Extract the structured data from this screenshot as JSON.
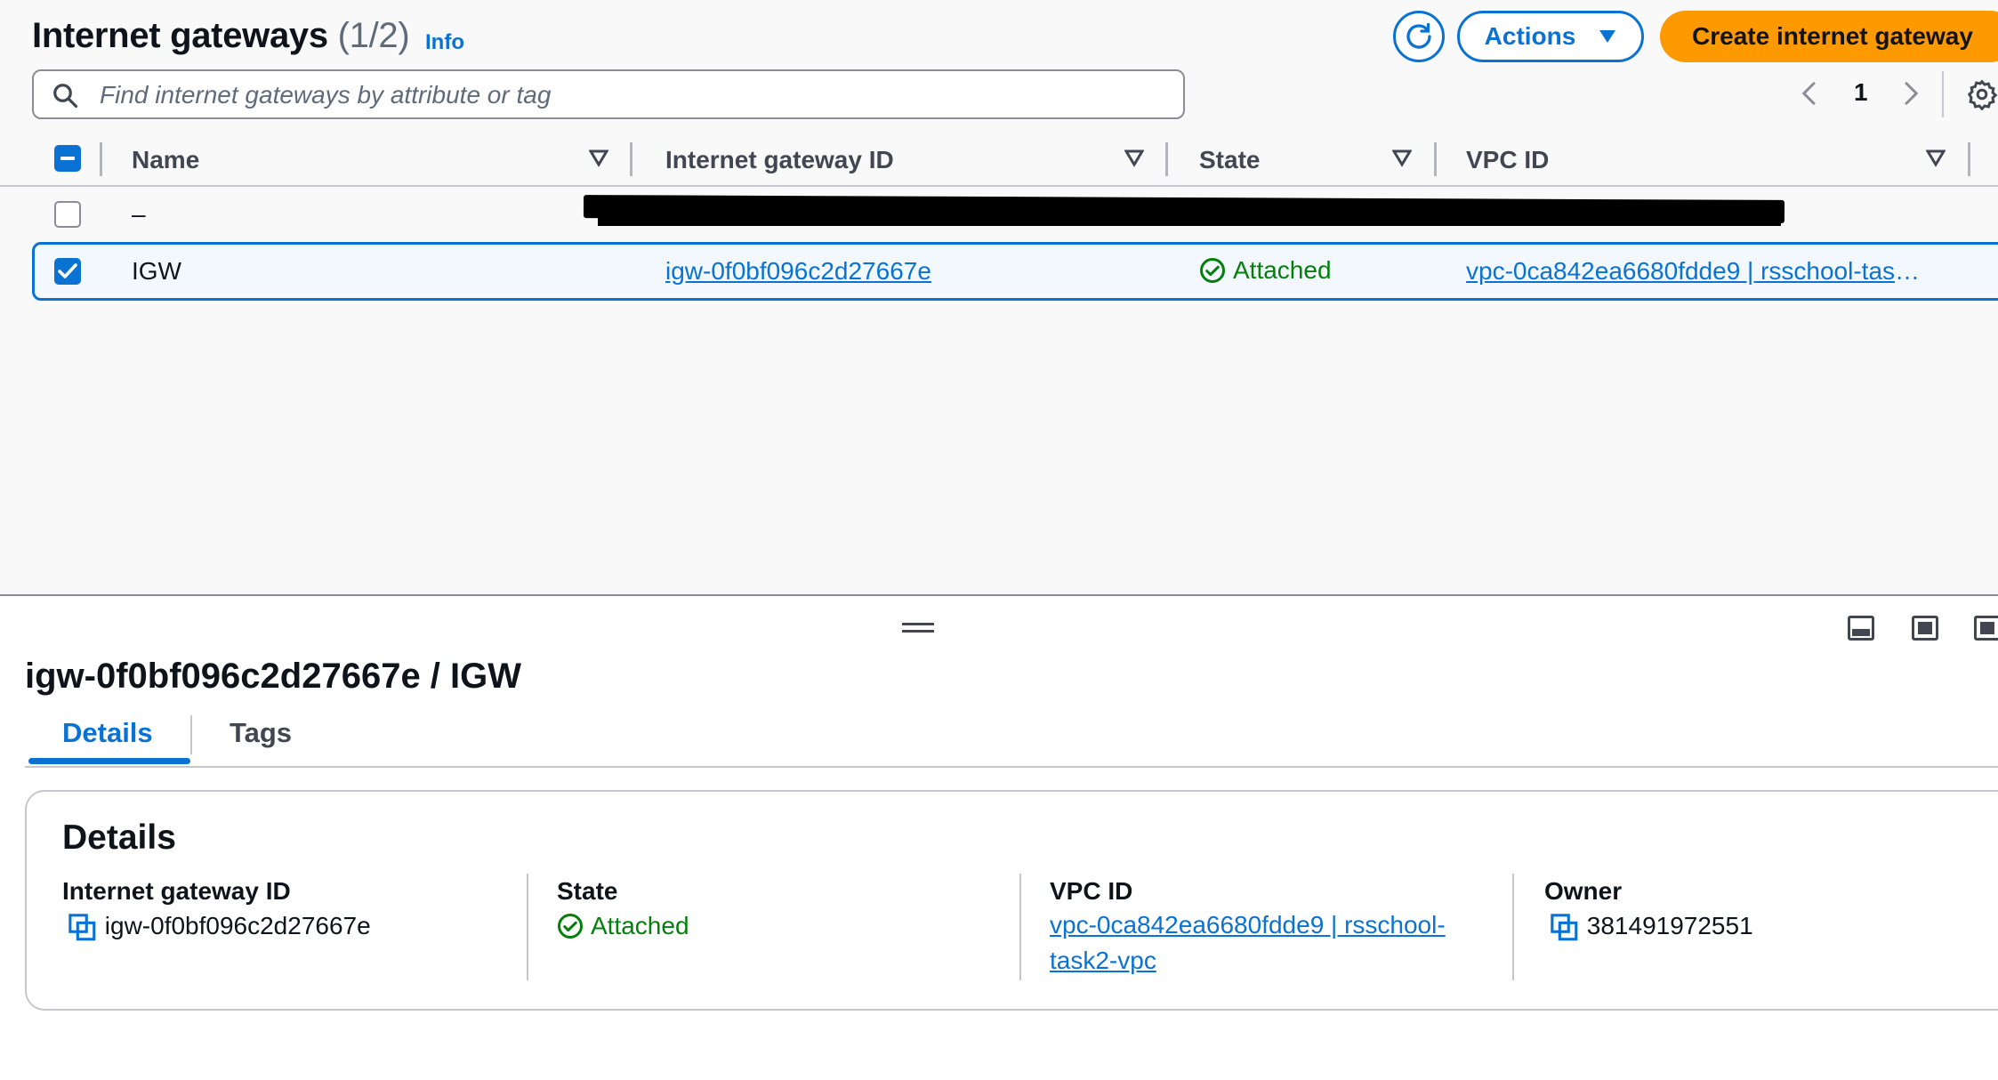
{
  "header": {
    "title": "Internet gateways",
    "count": "(1/2)",
    "info_label": "Info",
    "actions_label": "Actions",
    "create_label": "Create internet gateway"
  },
  "search": {
    "placeholder": "Find internet gateways by attribute or tag",
    "value": ""
  },
  "pagination": {
    "current_page": "1"
  },
  "table": {
    "columns": [
      "Name",
      "Internet gateway ID",
      "State",
      "VPC ID"
    ],
    "rows": [
      {
        "name": "–",
        "selected": false
      },
      {
        "name": "IGW",
        "igw_id": "igw-0f0bf096c2d27667e",
        "state": "Attached",
        "vpc_id": "vpc-0ca842ea6680fdde9 | rsschool-task2-vpc",
        "selected": true
      }
    ]
  },
  "detail": {
    "title": "igw-0f0bf096c2d27667e / IGW",
    "tabs": [
      {
        "label": "Details",
        "active": true
      },
      {
        "label": "Tags",
        "active": false
      }
    ],
    "card_title": "Details",
    "fields": {
      "igw_id": {
        "label": "Internet gateway ID",
        "value": "igw-0f0bf096c2d27667e"
      },
      "state": {
        "label": "State",
        "value": "Attached"
      },
      "vpc_id": {
        "label": "VPC ID",
        "value": "vpc-0ca842ea6680fdde9 | rsschool-task2-vpc"
      },
      "owner": {
        "label": "Owner",
        "value": "381491972551"
      }
    }
  },
  "colors": {
    "link": "#0972d3",
    "primary_button": "#ff9900",
    "success": "#037f0c",
    "panel_bg": "#f9f9fa"
  },
  "icons": [
    "refresh-icon",
    "caret-down-icon",
    "search-icon",
    "chevron-left-icon",
    "chevron-right-icon",
    "settings-icon",
    "sort-icon",
    "check-circle-icon",
    "copy-icon",
    "drag-handle-icon",
    "layout-icon"
  ]
}
